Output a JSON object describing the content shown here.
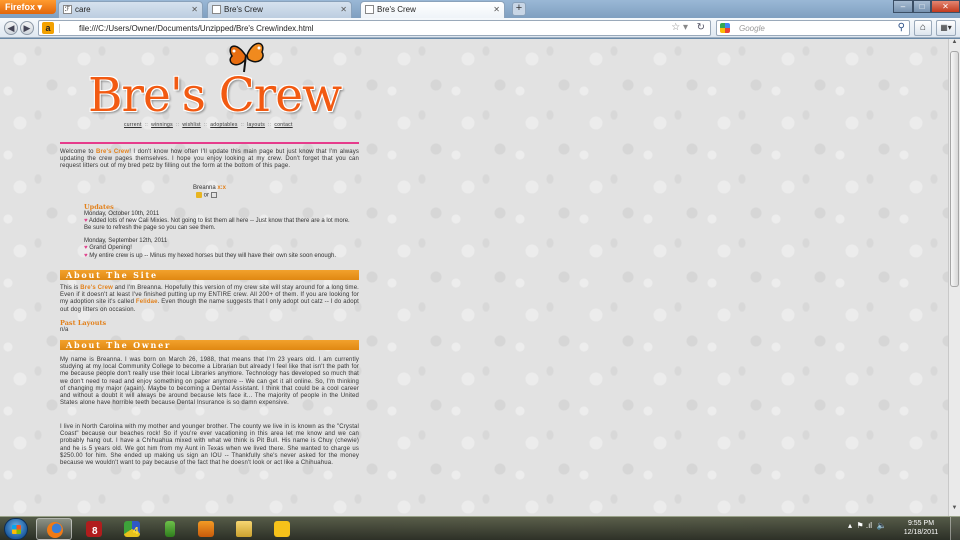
{
  "browser": {
    "app_button_label": "Firefox",
    "tabs": [
      {
        "title": "care",
        "icon": "tab-page-icon",
        "active": false
      },
      {
        "title": "Bre's Crew",
        "icon": "tab-page-icon",
        "active": false
      },
      {
        "title": "Bre's Crew",
        "icon": "tab-page-icon",
        "active": true
      }
    ],
    "new_tab_label": "+",
    "url": "file:///C:/Users/Owner/Documents/Unzipped/Bre's Crew/index.html",
    "search_placeholder": "Google"
  },
  "site": {
    "logo_text": "Bre's Crew",
    "nav": [
      "current",
      "winnings",
      "wishlist",
      "adoptables",
      "layouts",
      "contact"
    ],
    "welcome_lead": "Welcome to ",
    "welcome_name": "Bre's Crew",
    "welcome_text": "! I don't know how often I'll update this main page but just know that I'm always updating the crew pages themselves. I hope you enjoy looking at my crew. Don't forget that you can request litters out of my bred petz by filling out the form at the bottom of this page.",
    "signoff_name": "Breanna ",
    "signoff_xox": "x:x",
    "signoff_or": "or",
    "updates": {
      "heading": "Updates",
      "entries": [
        {
          "date": "Monday, October 10th, 2011",
          "items": [
            "Added lots of new Cali Mixies. Not going to list them all here -- Just know that there are a lot more. Be sure to refresh the page so you can see them."
          ]
        },
        {
          "date": "Monday, September 12th, 2011",
          "items": [
            "Grand Opening!",
            "My entire crew is up -- Minus my hexed horses but they will have their own site soon enough."
          ]
        }
      ]
    },
    "about_site": {
      "heading": "About The Site",
      "p_lead": "This is ",
      "p_name": "Bre's Crew",
      "p_mid": " and I'm Breanna. Hopefully this version of my crew site will stay around for a long time. Even if it doesn't at least I've finished putting up my ENTIRE crew. All 200+ of them. If you are looking for my adoption site it's called ",
      "p_link": "Felidae",
      "p_tail": ". Even though the name suggests that I only adopt out catz -- I do adopt out dog litters on occasion.",
      "past_layouts_heading": "Past Layouts",
      "past_layouts_value": "n/a"
    },
    "about_owner": {
      "heading": "About The Owner",
      "p1": "My name is Breanna. I was born on March 26, 1988, that means that I'm 23 years old. I am currently studying at my local Community College to become a Librarian but already I feel like that isn't the path for me because people don't really use their local Libraries anymore. Technology has developed so much that we don't need to read and enjoy something on paper anymore -- We can get it all online. So, I'm thinking of changing my major (again). Maybe to becoming a Dental Assistant. I think that could be a cool career and without a doubt it will always be around because lets face it... The majority of people in the United States alone have horrible teeth because Dental Insurance is so damn expensive.",
      "p2": "I live in North Carolina with my mother and younger brother. The county we live in is known as the \"Crystal Coast\" because our beaches rock! So if you're ever vacationing in this area let me know and we can probably hang out. I have a Chihuahua mixed with what we think is Pit Bull. His name is Chuy (chewie) and he is 5 years old. We got him from my Aunt in Texas when we lived there. She wanted to charge us $250.00 for him. She ended up making us sign an IOU -- Thankfully she's never asked for the money because we wouldn't want to pay because of the fact that he doesn't look or act like a Chihuahua."
    }
  },
  "taskbar": {
    "apps": [
      "firefox",
      "app2",
      "app3",
      "app4",
      "app5",
      "app6",
      "app7"
    ],
    "app2_badge": "8",
    "app3_badge": "4",
    "clock_time": "9:55 PM",
    "clock_date": "12/18/2011"
  },
  "colors": {
    "accent_orange": "#e2801a",
    "logo_orange": "#f25a12",
    "pink": "#e0418c"
  }
}
